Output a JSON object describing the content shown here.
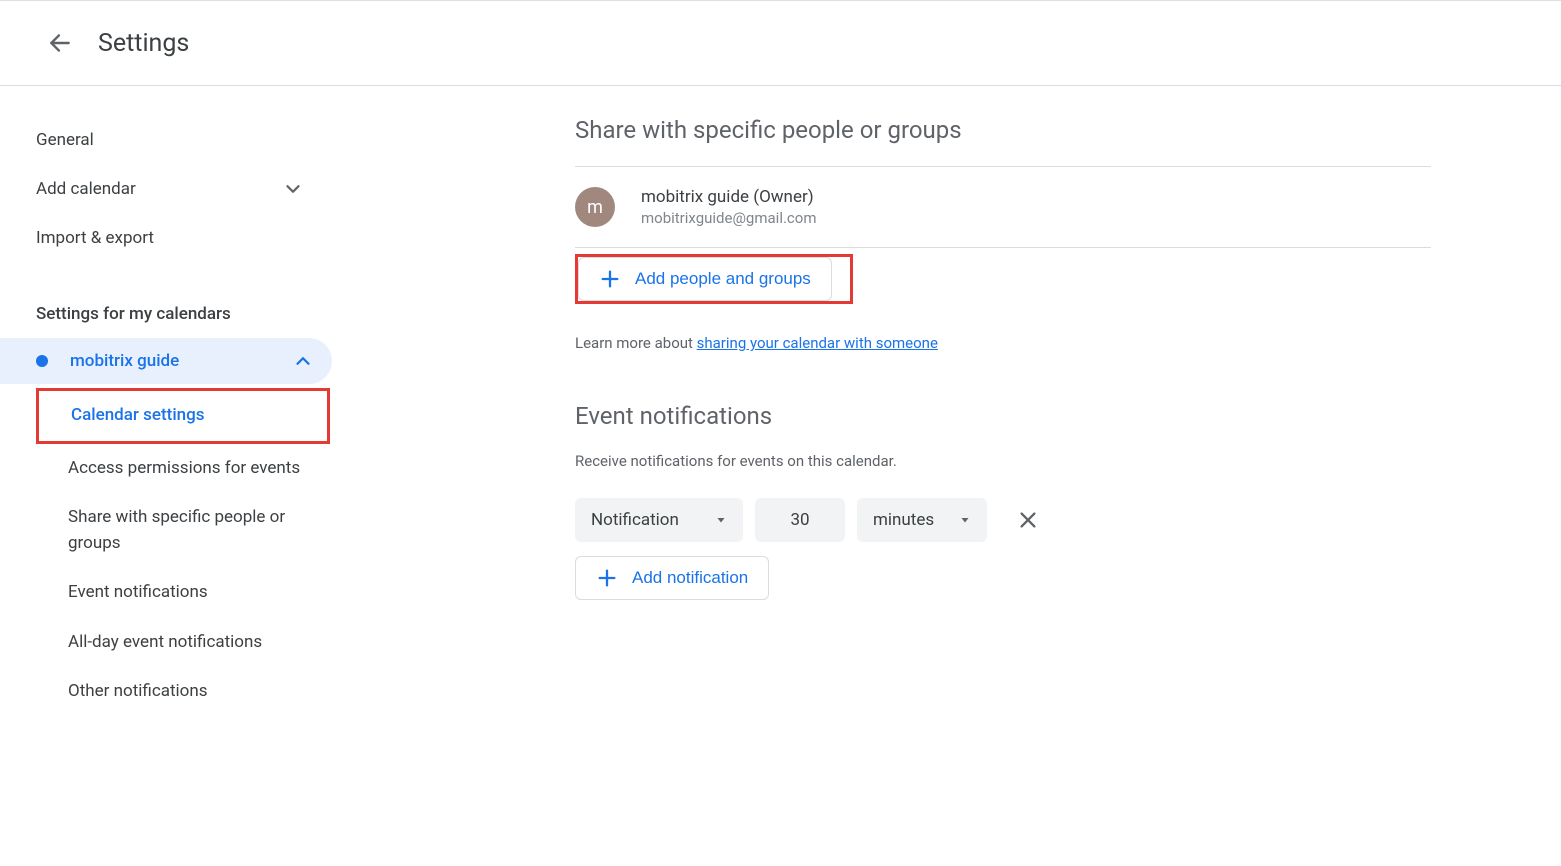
{
  "header": {
    "title": "Settings"
  },
  "sidebar": {
    "general": "General",
    "add_calendar": "Add calendar",
    "import_export": "Import & export",
    "my_calendars_heading": "Settings for my calendars",
    "calendar_name": "mobitrix guide",
    "sub": {
      "calendar_settings": "Calendar settings",
      "access_permissions": "Access permissions for events",
      "share_specific": "Share with specific people or groups",
      "event_notifications": "Event notifications",
      "allday_notifications": "All-day event notifications",
      "other_notifications": "Other notifications"
    }
  },
  "share_section": {
    "title": "Share with specific people or groups",
    "owner": {
      "initial": "m",
      "name": "mobitrix guide (Owner)",
      "email": "mobitrixguide@gmail.com"
    },
    "add_button": "Add people and groups",
    "learn_prefix": "Learn more about ",
    "learn_link": "sharing your calendar with someone"
  },
  "notif_section": {
    "title": "Event notifications",
    "subtitle": "Receive notifications for events on this calendar.",
    "method": "Notification",
    "amount": "30",
    "unit": "minutes",
    "add_button": "Add notification"
  }
}
